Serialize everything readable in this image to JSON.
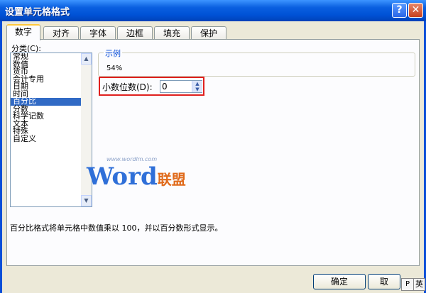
{
  "window": {
    "title": "设置单元格格式",
    "help": "?",
    "close": "✕"
  },
  "tabs": [
    {
      "label": "数字",
      "active": true
    },
    {
      "label": "对齐"
    },
    {
      "label": "字体"
    },
    {
      "label": "边框"
    },
    {
      "label": "填充"
    },
    {
      "label": "保护"
    }
  ],
  "category": {
    "label": "分类(C):",
    "items": [
      "常规",
      "数值",
      "货币",
      "会计专用",
      "日期",
      "时间",
      "百分比",
      "分数",
      "科学记数",
      "文本",
      "特殊",
      "自定义"
    ],
    "selected": "百分比"
  },
  "sample": {
    "label": "示例",
    "value": "54%"
  },
  "decimal": {
    "label": "小数位数(D):",
    "value": "0"
  },
  "watermark": {
    "url": "www.wordlm.com",
    "brand_w": "Word",
    "brand_cn": "联盟"
  },
  "description": "百分比格式将单元格中数值乘以 100，并以百分数形式显示。",
  "buttons": {
    "ok": "确定",
    "cancel": "取"
  },
  "taskbar": {
    "ime": "英"
  },
  "colors": {
    "titlebar": "#0052d6",
    "selection": "#316ac5",
    "highlight_box": "#e0201e",
    "group_label": "#0046d5"
  }
}
